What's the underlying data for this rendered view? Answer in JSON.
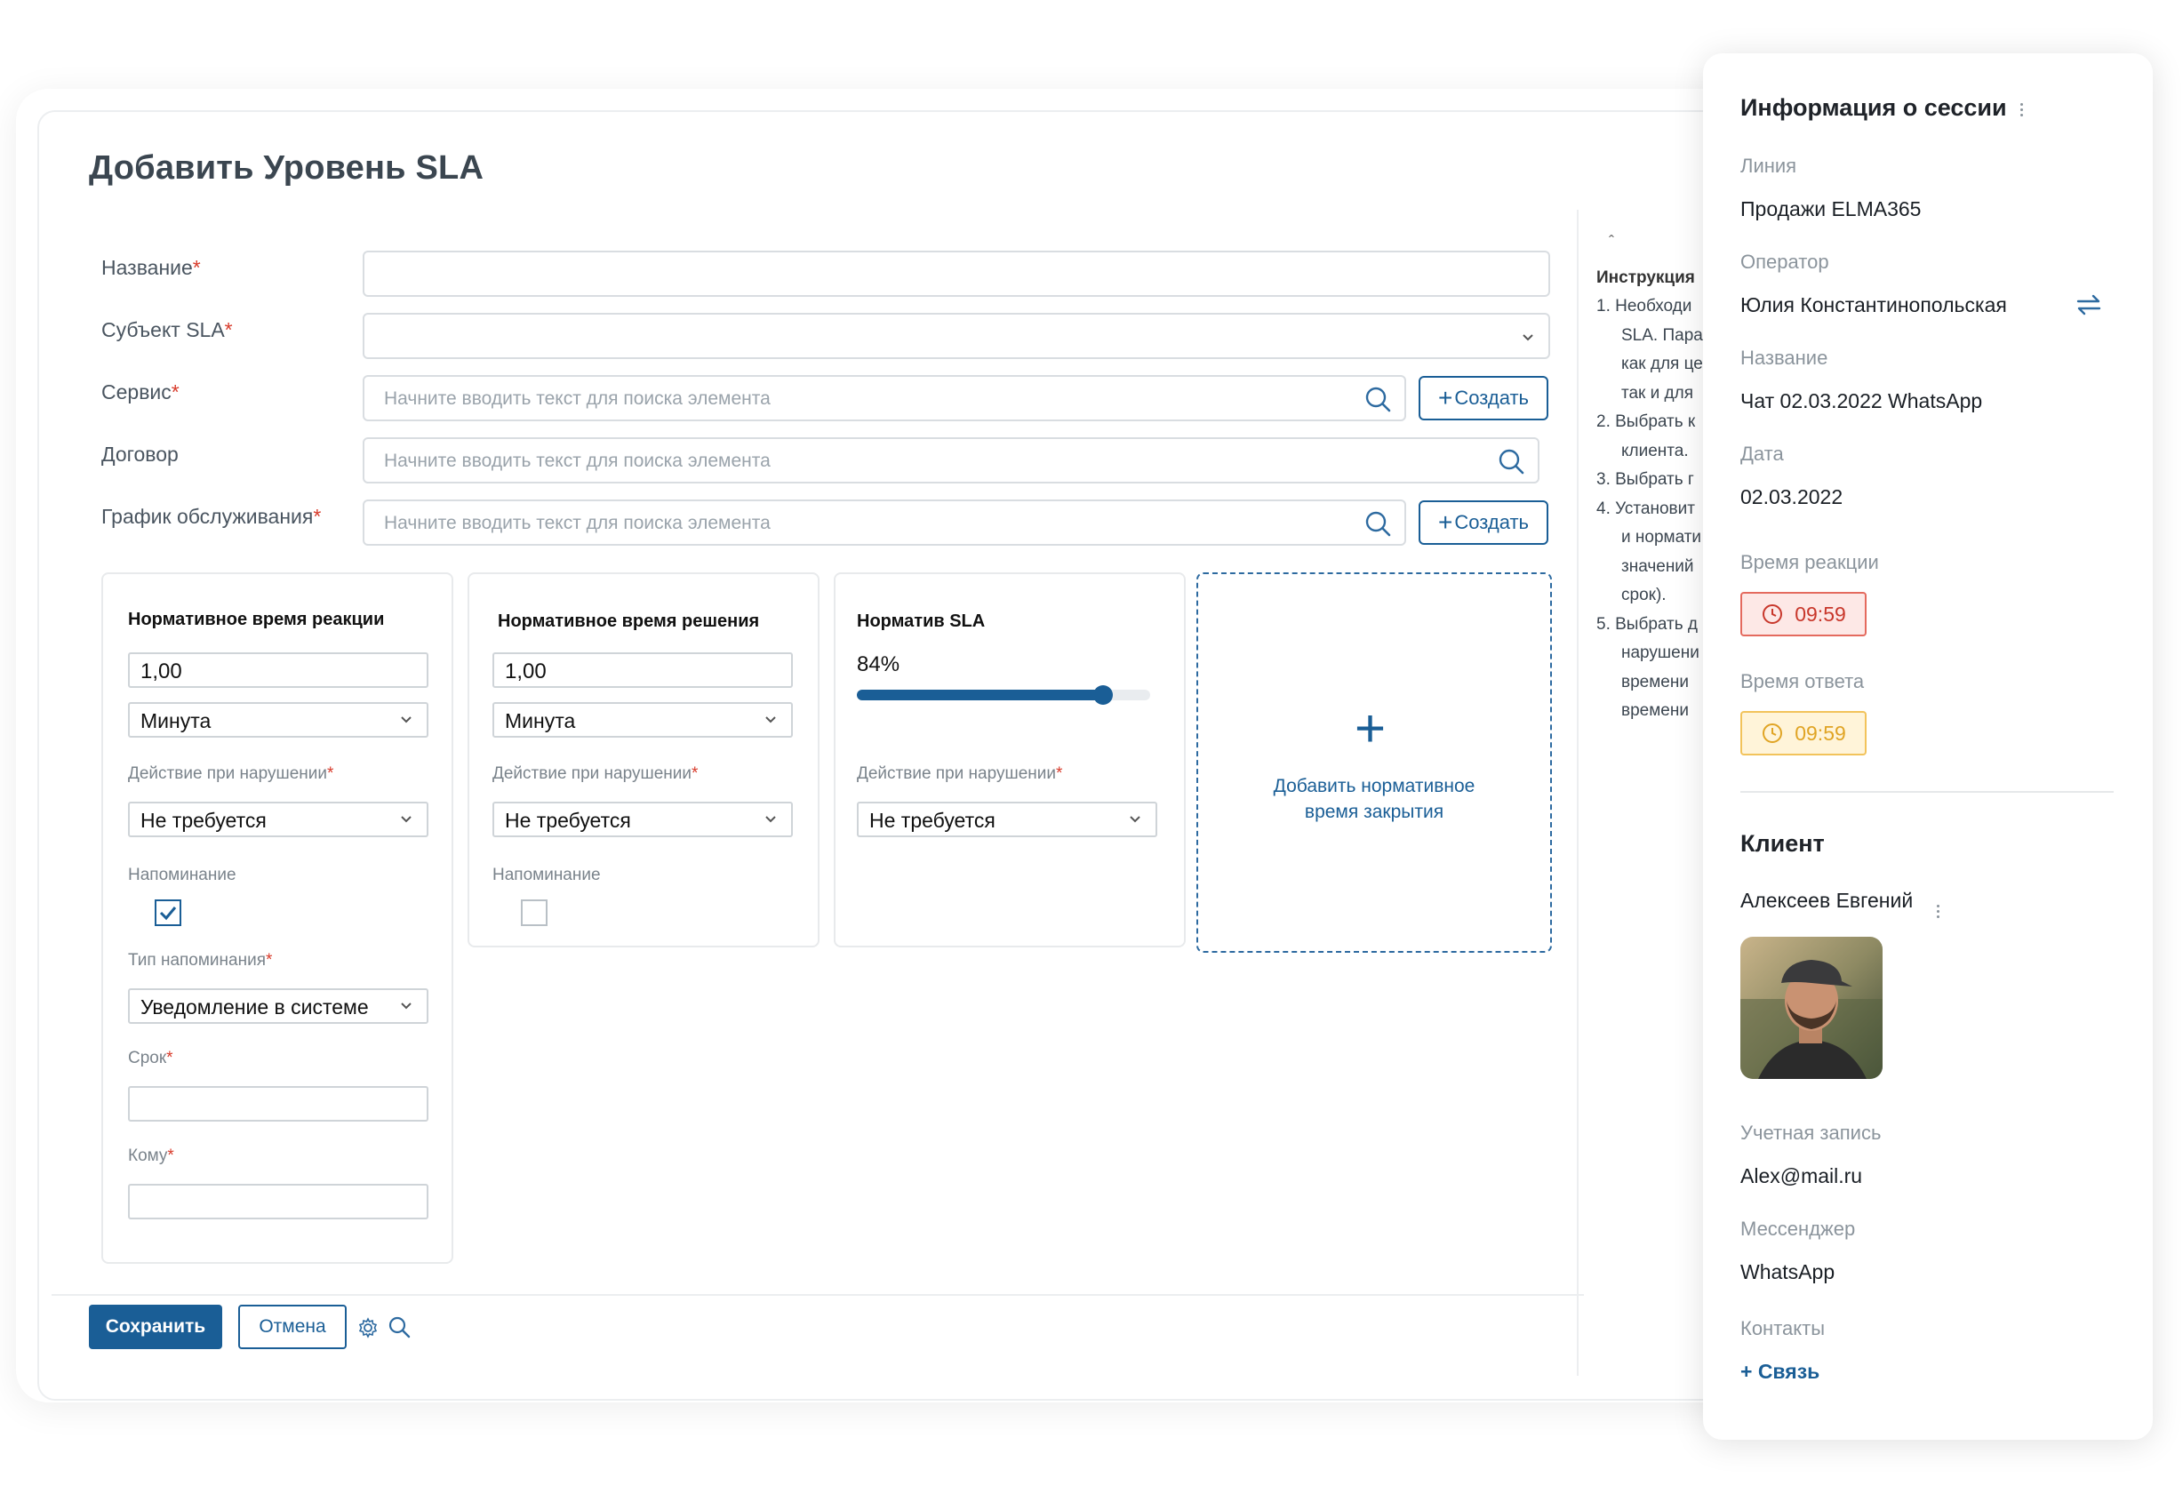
{
  "form": {
    "title": "Добавить Уровень SLA",
    "fields": [
      {
        "label": "Название",
        "required": true,
        "type": "text",
        "value": ""
      },
      {
        "label": "Субъект SLA",
        "required": true,
        "type": "select",
        "value": ""
      },
      {
        "label": "Сервис",
        "required": true,
        "type": "lookup",
        "placeholder": "Начните вводить текст для поиска элемента",
        "create_label": "Создать"
      },
      {
        "label": "Договор",
        "required": false,
        "type": "lookup",
        "placeholder": "Начните вводить текст для поиска элемента"
      },
      {
        "label": "График обслуживания",
        "required": true,
        "type": "lookup",
        "placeholder": "Начните вводить текст для поиска элемента",
        "create_label": "Создать"
      }
    ],
    "required_mark": "*"
  },
  "cards": {
    "reaction": {
      "title": "Нормативное время реакции",
      "value": "1,00",
      "unit": "Минута",
      "violation_label": "Действие при нарушении",
      "violation_value": "Не требуется",
      "reminder_label": "Напоминание",
      "reminder_checked": true,
      "reminder_type_label": "Тип напоминания",
      "reminder_type_value": "Уведомление в системе",
      "term_label": "Срок",
      "term_value": "",
      "to_label": "Кому",
      "to_value": ""
    },
    "resolution": {
      "title": "Нормативное время решения",
      "value": "1,00",
      "unit": "Минута",
      "violation_label": "Действие при нарушении",
      "violation_value": "Не требуется",
      "reminder_label": "Напоминание",
      "reminder_checked": false
    },
    "sla": {
      "title": "Норматив SLA",
      "percent_text": "84%",
      "percent": 84,
      "violation_label": "Действие при нарушении",
      "violation_value": "Не требуется"
    },
    "add_closing": {
      "label_line1": "Добавить нормативное",
      "label_line2": "время закрытия"
    }
  },
  "footer": {
    "save_label": "Сохранить",
    "cancel_label": "Отмена"
  },
  "instructions": {
    "title": "Инструкция",
    "lines": [
      "1. Необходи",
      "SLA. Пара",
      "как для це",
      "так и для",
      "2. Выбрать к",
      "клиента.",
      "3. Выбрать г",
      "4. Установит",
      "и нормати",
      "значений",
      "срок).",
      "5. Выбрать д",
      "нарушени",
      "времени",
      "времени"
    ]
  },
  "session": {
    "title": "Информация о сессии",
    "line_label": "Линия",
    "line_value": "Продажи ELMA365",
    "operator_label": "Оператор",
    "operator_value": "Юлия Константинопольская",
    "name_label": "Название",
    "name_value": "Чат 02.03.2022 WhatsApp",
    "date_label": "Дата",
    "date_value": "02.03.2022",
    "reaction_label": "Время реакции",
    "reaction_value": "09:59",
    "answer_label": "Время ответа",
    "answer_value": "09:59",
    "client_title": "Клиент",
    "client_name": "Алексеев Евгений",
    "account_label": "Учетная запись",
    "account_value": "Alex@mail.ru",
    "messenger_label": "Мессенджер",
    "messenger_value": "WhatsApp",
    "contacts_label": "Контакты",
    "add_link_label": "+ Связь"
  },
  "colors": {
    "accent": "#1a5e96",
    "required": "#d83b2b",
    "badge_red": "#c8372b",
    "badge_yellow": "#e0a424"
  }
}
